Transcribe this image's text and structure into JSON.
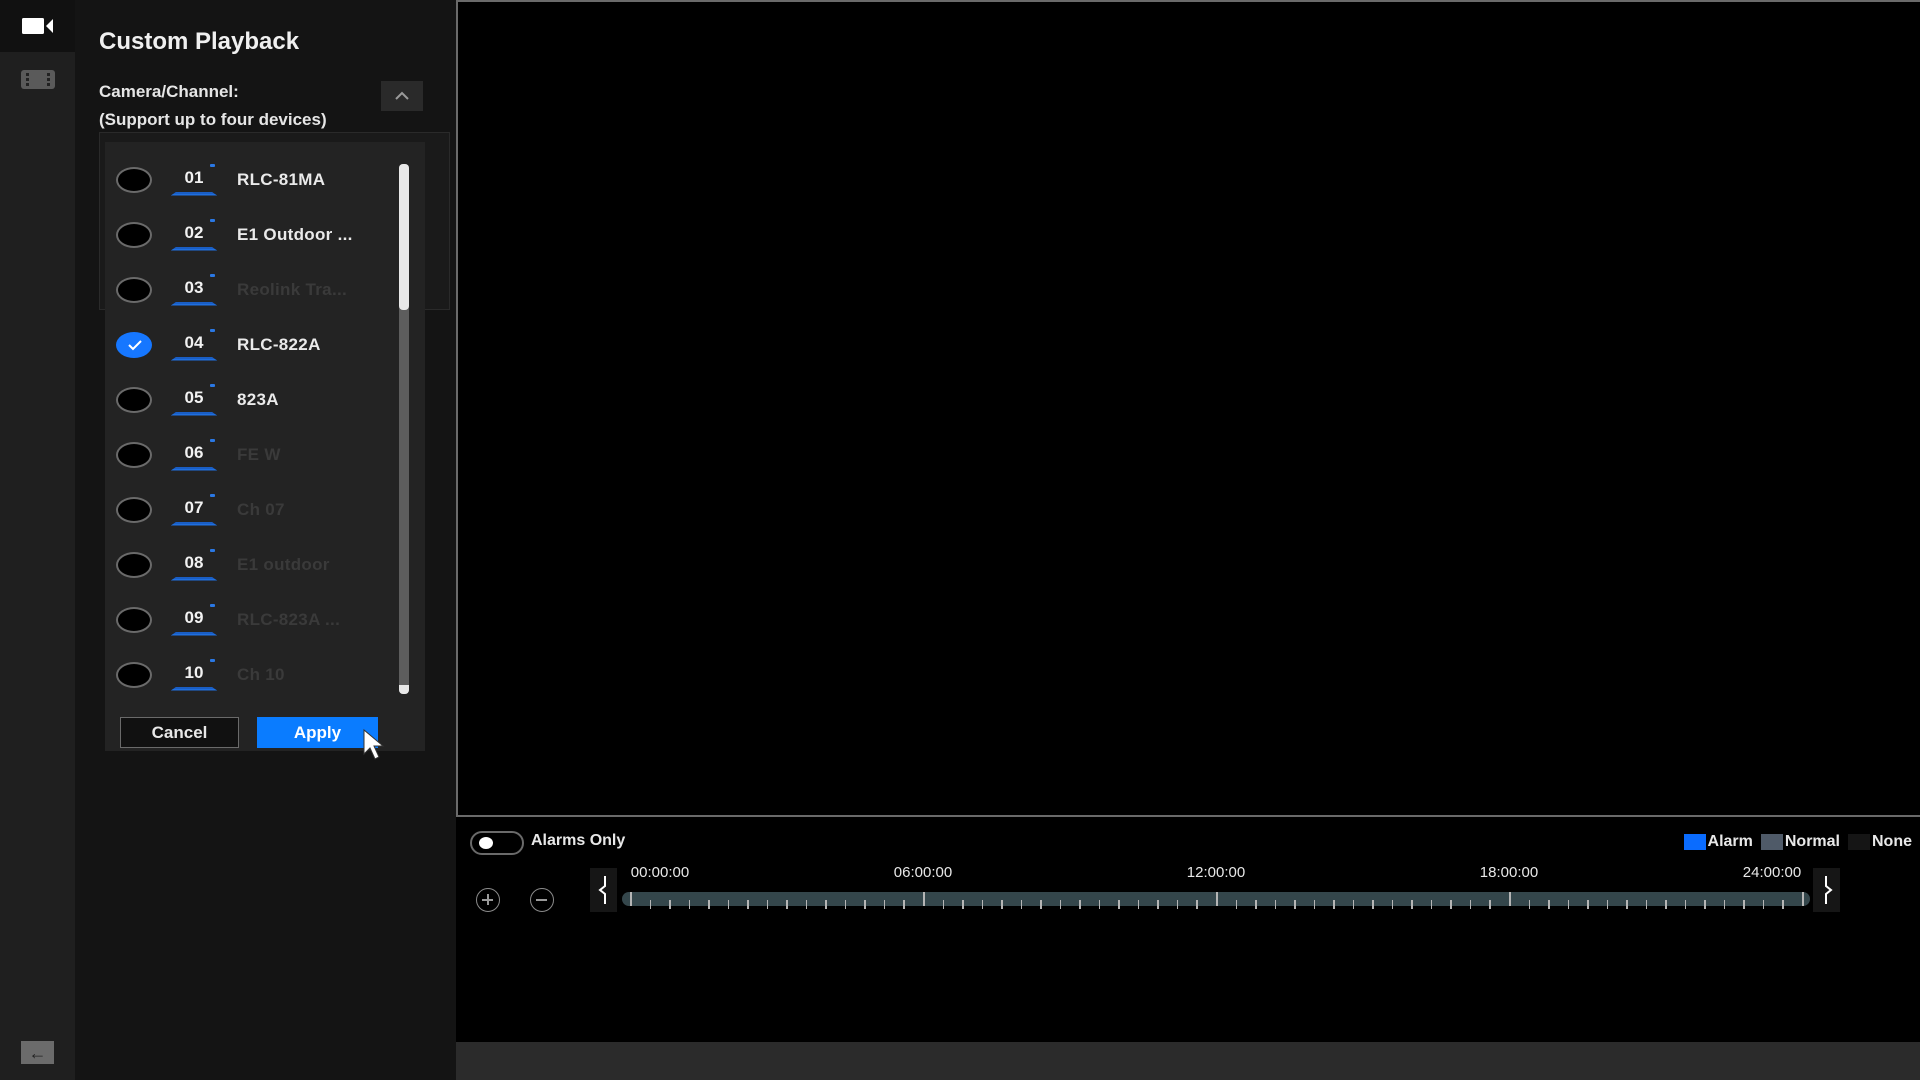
{
  "nav": {
    "items": [
      {
        "icon": "video-camera-icon",
        "active": true
      },
      {
        "icon": "film-strip-icon",
        "active": false
      }
    ],
    "back_icon": "back-arrow-icon"
  },
  "panel": {
    "title": "Custom Playback",
    "camera_label": "Camera/Channel:",
    "camera_hint": "(Support up to four devices)",
    "collapse_icon": "chevron-up-icon",
    "channels": [
      {
        "num": "01",
        "name": "RLC-81MA",
        "checked": false,
        "online": true
      },
      {
        "num": "02",
        "name": "E1 Outdoor ...",
        "checked": false,
        "online": true
      },
      {
        "num": "03",
        "name": "Reolink Tra...",
        "checked": false,
        "online": false
      },
      {
        "num": "04",
        "name": "RLC-822A",
        "checked": true,
        "online": true
      },
      {
        "num": "05",
        "name": "823A",
        "checked": false,
        "online": true
      },
      {
        "num": "06",
        "name": "FE W",
        "checked": false,
        "online": false
      },
      {
        "num": "07",
        "name": "Ch 07",
        "checked": false,
        "online": false
      },
      {
        "num": "08",
        "name": "E1 outdoor",
        "checked": false,
        "online": false
      },
      {
        "num": "09",
        "name": "RLC-823A ...",
        "checked": false,
        "online": false
      },
      {
        "num": "10",
        "name": "Ch 10",
        "checked": false,
        "online": false
      }
    ],
    "cancel_label": "Cancel",
    "apply_label": "Apply"
  },
  "controls": {
    "alarms_only_label": "Alarms Only",
    "alarms_only_on": false,
    "legend": [
      {
        "label": "Alarm",
        "color": "#0a6cff"
      },
      {
        "label": "Normal",
        "color": "#4f5a68"
      },
      {
        "label": "None",
        "color": "#1a1a1a"
      }
    ],
    "timeline": {
      "labels": [
        "00:00:00",
        "06:00:00",
        "12:00:00",
        "18:00:00",
        "24:00:00"
      ],
      "hours_span": 24,
      "minor_tick_minutes": 24
    }
  },
  "colors": {
    "accent": "#0a7cff",
    "timeline_track": "#34464b"
  }
}
